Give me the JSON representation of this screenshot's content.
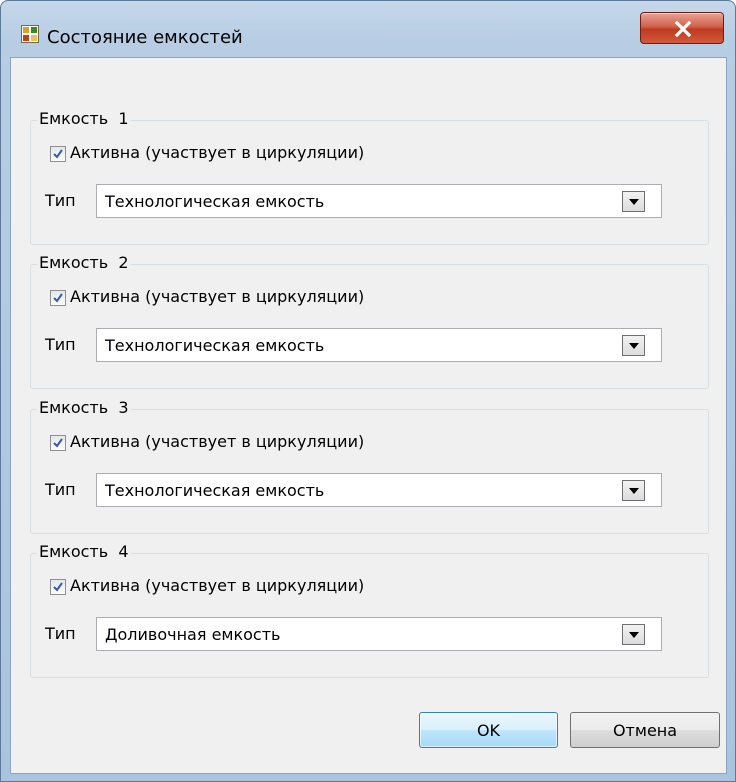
{
  "window": {
    "title": "Состояние емкостей"
  },
  "groups": [
    {
      "legend": "Емкость  1",
      "active_label": "Активна (участвует в циркуляции)",
      "active_checked": true,
      "type_label": "Тип",
      "type_value": "Технологическая емкость"
    },
    {
      "legend": "Емкость  2",
      "active_label": "Активна (участвует в циркуляции)",
      "active_checked": true,
      "type_label": "Тип",
      "type_value": "Технологическая емкость"
    },
    {
      "legend": "Емкость  3",
      "active_label": "Активна (участвует в циркуляции)",
      "active_checked": true,
      "type_label": "Тип",
      "type_value": "Технологическая емкость"
    },
    {
      "legend": "Емкость  4",
      "active_label": "Активна (участвует в циркуляции)",
      "active_checked": true,
      "type_label": "Тип",
      "type_value": "Доливочная емкость"
    }
  ],
  "buttons": {
    "ok": "OK",
    "cancel": "Отмена"
  },
  "icons": {
    "app": "grid-app-icon",
    "close": "close-icon",
    "dropdown": "chevron-down-icon",
    "check": "checkmark-icon"
  }
}
